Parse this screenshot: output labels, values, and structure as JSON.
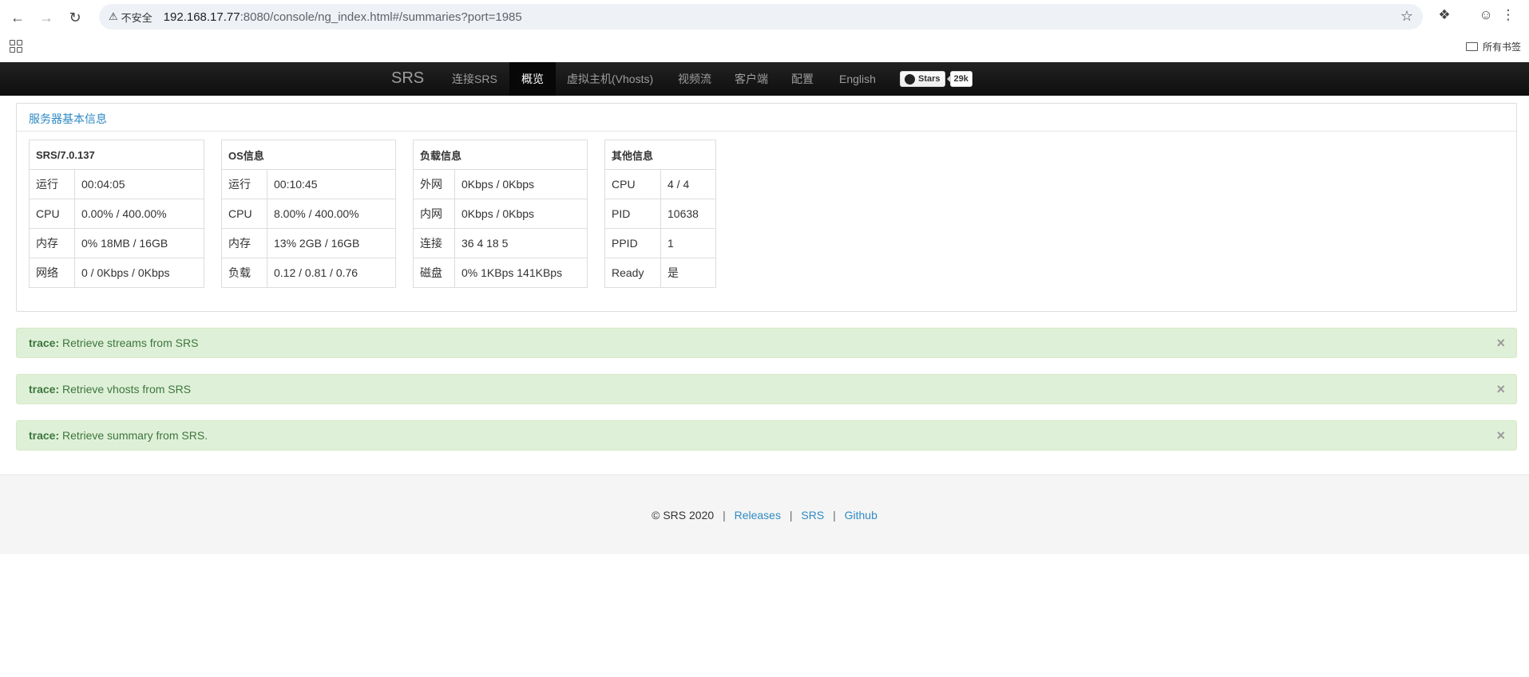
{
  "browser": {
    "insecure_label": "不安全",
    "url_host": "192.168.17.77",
    "url_path": ":8080/console/ng_index.html#/summaries?port=1985",
    "all_bookmarks": "所有书签"
  },
  "navbar": {
    "brand": "SRS",
    "items": [
      "连接SRS",
      "概览",
      "虚拟主机(Vhosts)",
      "视频流",
      "客户端",
      "配置",
      "English"
    ],
    "active_index": 1,
    "github": {
      "label": "Stars",
      "count": "29k"
    }
  },
  "panel": {
    "title": "服务器基本信息",
    "tables": [
      {
        "header": "SRS/7.0.137",
        "rows": [
          [
            "运行",
            "00:04:05"
          ],
          [
            "CPU",
            "0.00% / 400.00%"
          ],
          [
            "内存",
            "0% 18MB / 16GB"
          ],
          [
            "网络",
            "0 / 0Kbps / 0Kbps"
          ]
        ]
      },
      {
        "header": "OS信息",
        "rows": [
          [
            "运行",
            "00:10:45"
          ],
          [
            "CPU",
            "8.00% / 400.00%"
          ],
          [
            "内存",
            "13% 2GB / 16GB"
          ],
          [
            "负载",
            "0.12 / 0.81 / 0.76"
          ]
        ]
      },
      {
        "header": "负载信息",
        "rows": [
          [
            "外网",
            "0Kbps / 0Kbps"
          ],
          [
            "内网",
            "0Kbps / 0Kbps"
          ],
          [
            "连接",
            "36 4 18 5"
          ],
          [
            "磁盘",
            "0% 1KBps 141KBps"
          ]
        ]
      },
      {
        "header": "其他信息",
        "rows": [
          [
            "CPU",
            "4 / 4"
          ],
          [
            "PID",
            "10638"
          ],
          [
            "PPID",
            "1"
          ],
          [
            "Ready",
            "是"
          ]
        ]
      }
    ]
  },
  "alerts": [
    {
      "level": "trace:",
      "message": "Retrieve streams from SRS"
    },
    {
      "level": "trace:",
      "message": "Retrieve vhosts from SRS"
    },
    {
      "level": "trace:",
      "message": "Retrieve summary from SRS."
    }
  ],
  "footer": {
    "copyright": "© SRS 2020",
    "links": [
      "Releases",
      "SRS",
      "Github"
    ],
    "separator": "|"
  },
  "colors": {
    "navbar_bg": "#111111",
    "link": "#2f8ac4",
    "alert_bg": "#dff0d8",
    "alert_text": "#3c763d"
  }
}
